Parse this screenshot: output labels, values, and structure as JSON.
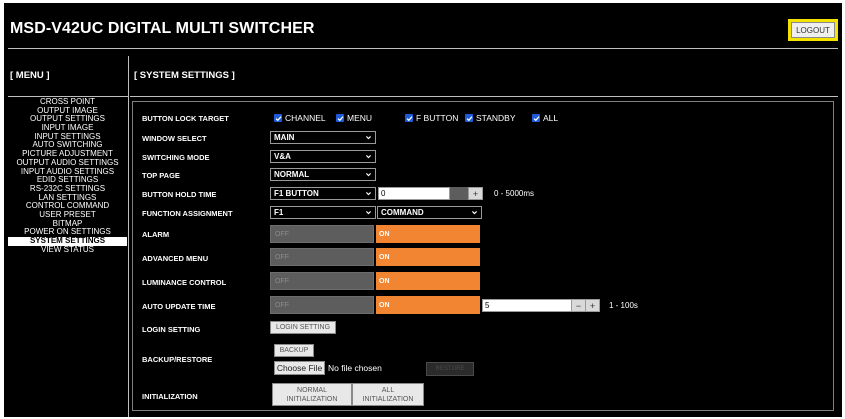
{
  "header": {
    "title": "MSD-V42UC DIGITAL MULTI SWITCHER",
    "logout_label": "LOGOUT"
  },
  "menu": {
    "title": "[ MENU ]",
    "items": [
      "CROSS POINT",
      "OUTPUT IMAGE",
      "OUTPUT SETTINGS",
      "INPUT IMAGE",
      "INPUT SETTINGS",
      "AUTO SWITCHING",
      "PICTURE ADJUSTMENT",
      "OUTPUT AUDIO SETTINGS",
      "INPUT AUDIO SETTINGS",
      "EDID SETTINGS",
      "RS-232C SETTINGS",
      "LAN SETTINGS",
      "CONTROL COMMAND",
      "USER PRESET",
      "BITMAP",
      "POWER ON SETTINGS",
      "SYSTEM SETTINGS",
      "VIEW STATUS"
    ],
    "active": "SYSTEM SETTINGS"
  },
  "content": {
    "title": "[ SYSTEM SETTINGS ]",
    "button_lock": {
      "label": "BUTTON LOCK TARGET",
      "options": [
        "CHANNEL",
        "MENU",
        "F BUTTON",
        "STANDBY",
        "ALL"
      ]
    },
    "window_select": {
      "label": "WINDOW SELECT",
      "value": "MAIN"
    },
    "switching_mode": {
      "label": "SWITCHING MODE",
      "value": "V&A"
    },
    "top_page": {
      "label": "TOP PAGE",
      "value": "NORMAL"
    },
    "button_hold": {
      "label": "BUTTON HOLD TIME",
      "select": "F1 BUTTON",
      "value": "0",
      "range": "0 - 5000ms"
    },
    "function_assign": {
      "label": "FUNCTION ASSIGNMENT",
      "select": "F1",
      "command": "COMMAND"
    },
    "alarm": {
      "label": "ALARM",
      "off": "OFF",
      "on": "ON",
      "state": "ON"
    },
    "advanced_menu": {
      "label": "ADVANCED MENU",
      "off": "OFF",
      "on": "ON",
      "state": "ON"
    },
    "luminance": {
      "label": "LUMINANCE CONTROL",
      "off": "OFF",
      "on": "ON",
      "state": "ON"
    },
    "auto_update": {
      "label": "AUTO UPDATE TIME",
      "off": "OFF",
      "on": "ON",
      "state": "ON",
      "value": "5",
      "range": "1 - 100s"
    },
    "login_setting": {
      "label": "LOGIN SETTING",
      "button": "LOGIN SETTING"
    },
    "backup_restore": {
      "label": "BACKUP/RESTORE",
      "backup": "BACKUP",
      "choose_file": "Choose File",
      "no_file": "No file chosen",
      "restore": "RESTORE"
    },
    "initialization": {
      "label": "INITIALIZATION",
      "normal": "NORMAL INITIALIZATION",
      "all": "ALL INITIALIZATION"
    }
  },
  "colors": {
    "background": "#000000",
    "on_active": "#f28531",
    "off_inactive": "#5d5d5d",
    "logout_highlight": "#f4e300",
    "checkbox": "#1e5bd8"
  }
}
